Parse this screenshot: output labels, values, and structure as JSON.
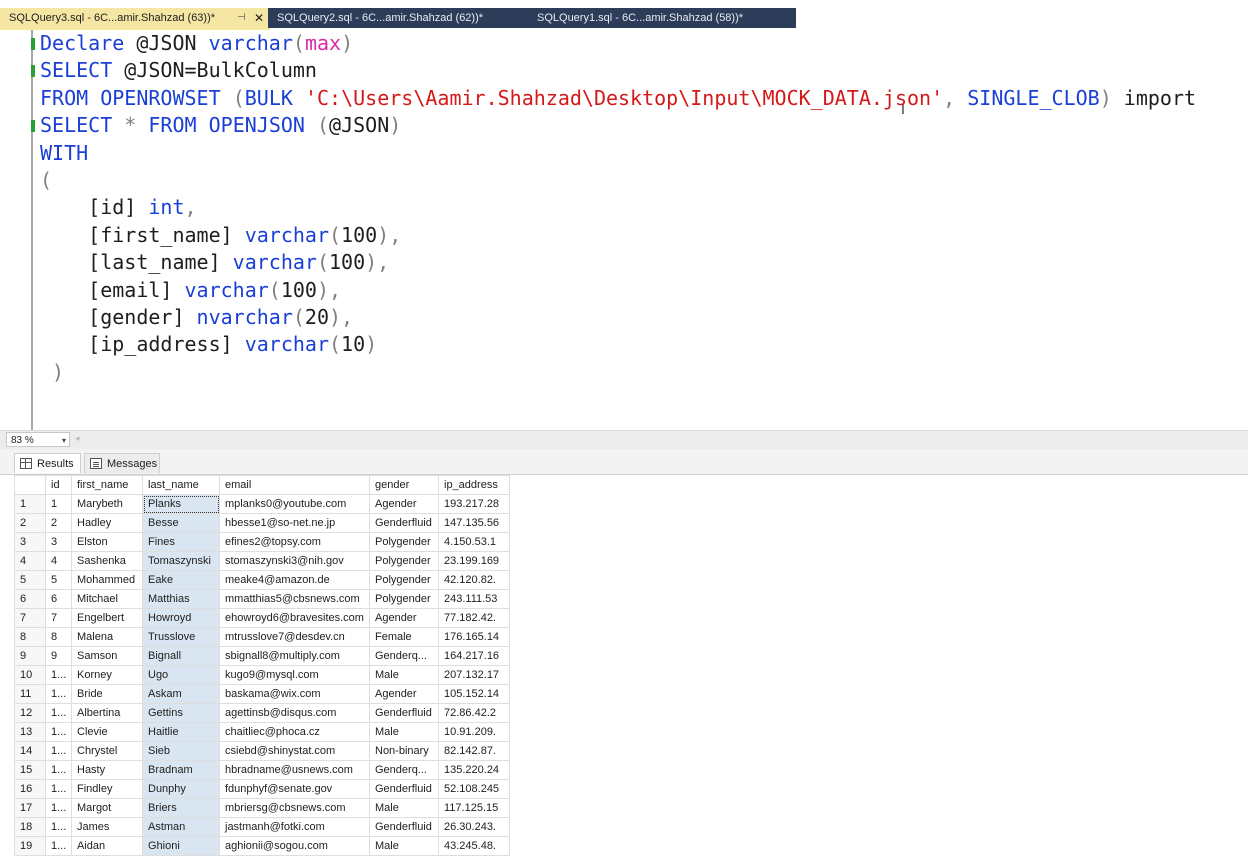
{
  "tabs": [
    {
      "label": "SQLQuery3.sql - 6C...amir.Shahzad (63))*",
      "pin": "⊣",
      "close": "✕"
    },
    {
      "label": "SQLQuery2.sql - 6C...amir.Shahzad (62))*"
    },
    {
      "label": "SQLQuery1.sql - 6C...amir.Shahzad (58))*"
    }
  ],
  "editor": {
    "lines": [
      [
        [
          "kw",
          "Declare"
        ],
        [
          "t",
          " @JSON "
        ],
        [
          "kw",
          "varchar"
        ],
        [
          "gr",
          "("
        ],
        [
          "fn",
          "max"
        ],
        [
          "gr",
          ")"
        ]
      ],
      [
        [
          "kw",
          "SELECT"
        ],
        [
          "t",
          " @JSON=BulkColumn"
        ]
      ],
      [
        [
          "kw",
          "FROM"
        ],
        [
          "t",
          " "
        ],
        [
          "kw",
          "OPENROWSET"
        ],
        [
          "t",
          " "
        ],
        [
          "gr",
          "("
        ],
        [
          "kw",
          "BULK"
        ],
        [
          "t",
          " "
        ],
        [
          "str",
          "'C:\\Users\\Aamir.Shahzad\\Desktop\\Input\\MOCK_DATA.json'"
        ],
        [
          "gr",
          ","
        ],
        [
          "t",
          " "
        ],
        [
          "kw",
          "SINGLE_CLOB"
        ],
        [
          "gr",
          ")"
        ],
        [
          "t",
          " import"
        ]
      ],
      [
        [
          "kw",
          "SELECT"
        ],
        [
          "t",
          " "
        ],
        [
          "gr",
          "*"
        ],
        [
          "t",
          " "
        ],
        [
          "kw",
          "FROM"
        ],
        [
          "t",
          " "
        ],
        [
          "kw",
          "OPENJSON"
        ],
        [
          "t",
          " "
        ],
        [
          "gr",
          "("
        ],
        [
          "t",
          "@JSON"
        ],
        [
          "gr",
          ")"
        ]
      ],
      [
        [
          "kw",
          "WITH"
        ]
      ],
      [
        [
          "gr",
          "("
        ]
      ],
      [
        [
          "t",
          "    [id] "
        ],
        [
          "kw",
          "int"
        ],
        [
          "gr",
          ","
        ]
      ],
      [
        [
          "t",
          "    [first_name] "
        ],
        [
          "kw",
          "varchar"
        ],
        [
          "gr",
          "("
        ],
        [
          "t",
          "100"
        ],
        [
          "gr",
          "),"
        ]
      ],
      [
        [
          "t",
          "    [last_name] "
        ],
        [
          "kw",
          "varchar"
        ],
        [
          "gr",
          "("
        ],
        [
          "t",
          "100"
        ],
        [
          "gr",
          "),"
        ]
      ],
      [
        [
          "t",
          "    [email] "
        ],
        [
          "kw",
          "varchar"
        ],
        [
          "gr",
          "("
        ],
        [
          "t",
          "100"
        ],
        [
          "gr",
          "),"
        ]
      ],
      [
        [
          "t",
          "    [gender] "
        ],
        [
          "kw",
          "nvarchar"
        ],
        [
          "gr",
          "("
        ],
        [
          "t",
          "20"
        ],
        [
          "gr",
          "),"
        ]
      ],
      [
        [
          "t",
          "    [ip_address] "
        ],
        [
          "kw",
          "varchar"
        ],
        [
          "gr",
          "("
        ],
        [
          "t",
          "10"
        ],
        [
          "gr",
          ")"
        ]
      ],
      [
        [
          "gr",
          " )"
        ]
      ]
    ],
    "caret": "I"
  },
  "zoom": {
    "value": "83 %",
    "arrow": "▾",
    "scroll_left": "◂"
  },
  "result_tabs": {
    "results": "Results",
    "messages": "Messages"
  },
  "grid": {
    "columns": [
      "",
      "id",
      "first_name",
      "last_name",
      "email",
      "gender",
      "ip_address"
    ],
    "rows": [
      [
        "1",
        "1",
        "Marybeth",
        "Planks",
        "mplanks0@youtube.com",
        "Agender",
        "193.217.28"
      ],
      [
        "2",
        "2",
        "Hadley",
        "Besse",
        "hbesse1@so-net.ne.jp",
        "Genderfluid",
        "147.135.56"
      ],
      [
        "3",
        "3",
        "Elston",
        "Fines",
        "efines2@topsy.com",
        "Polygender",
        "4.150.53.1"
      ],
      [
        "4",
        "4",
        "Sashenka",
        "Tomaszynski",
        "stomaszynski3@nih.gov",
        "Polygender",
        "23.199.169"
      ],
      [
        "5",
        "5",
        "Mohammed",
        "Eake",
        "meake4@amazon.de",
        "Polygender",
        "42.120.82."
      ],
      [
        "6",
        "6",
        "Mitchael",
        "Matthias",
        "mmatthias5@cbsnews.com",
        "Polygender",
        "243.111.53"
      ],
      [
        "7",
        "7",
        "Engelbert",
        "Howroyd",
        "ehowroyd6@bravesites.com",
        "Agender",
        "77.182.42."
      ],
      [
        "8",
        "8",
        "Malena",
        "Trusslove",
        "mtrusslove7@desdev.cn",
        "Female",
        "176.165.14"
      ],
      [
        "9",
        "9",
        "Samson",
        "Bignall",
        "sbignall8@multiply.com",
        "Genderq...",
        "164.217.16"
      ],
      [
        "10",
        "1...",
        "Korney",
        "Ugo",
        "kugo9@mysql.com",
        "Male",
        "207.132.17"
      ],
      [
        "11",
        "1...",
        "Bride",
        "Askam",
        "baskama@wix.com",
        "Agender",
        "105.152.14"
      ],
      [
        "12",
        "1...",
        "Albertina",
        "Gettins",
        "agettinsb@disqus.com",
        "Genderfluid",
        "72.86.42.2"
      ],
      [
        "13",
        "1...",
        "Clevie",
        "Haitlie",
        "chaitliec@phoca.cz",
        "Male",
        "10.91.209."
      ],
      [
        "14",
        "1...",
        "Chrystel",
        "Sieb",
        "csiebd@shinystat.com",
        "Non-binary",
        "82.142.87."
      ],
      [
        "15",
        "1...",
        "Hasty",
        "Bradnam",
        "hbradname@usnews.com",
        "Genderq...",
        "135.220.24"
      ],
      [
        "16",
        "1...",
        "Findley",
        "Dunphy",
        "fdunphyf@senate.gov",
        "Genderfluid",
        "52.108.245"
      ],
      [
        "17",
        "1...",
        "Margot",
        "Briers",
        "mbriersg@cbsnews.com",
        "Male",
        "117.125.15"
      ],
      [
        "18",
        "1...",
        "James",
        "Astman",
        "jastmanh@fotki.com",
        "Genderfluid",
        "26.30.243."
      ],
      [
        "19",
        "1...",
        "Aidan",
        "Ghioni",
        "aghionii@sogou.com",
        "Male",
        "43.245.48."
      ]
    ]
  }
}
